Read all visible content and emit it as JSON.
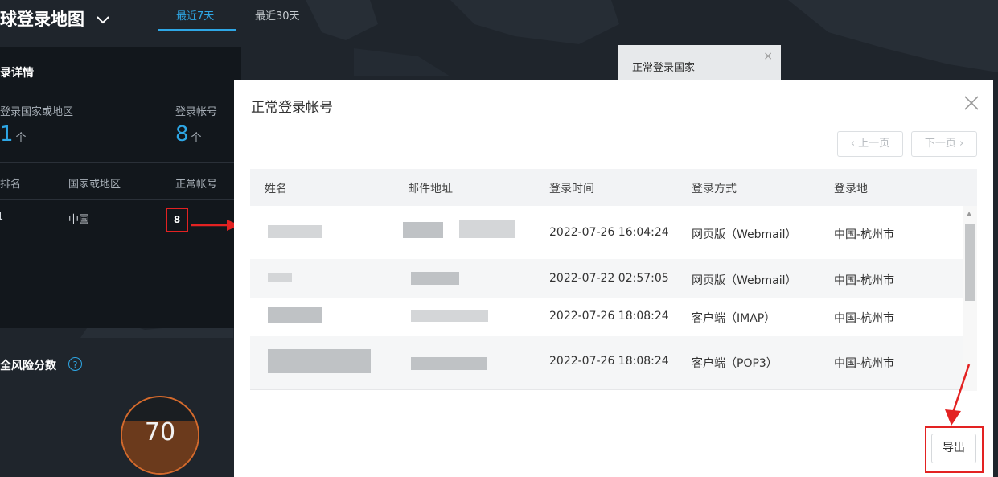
{
  "header": {
    "title": "球登录地图",
    "tabs": [
      {
        "label": "最近7天",
        "active": true
      },
      {
        "label": "最近30天",
        "active": false
      }
    ]
  },
  "details": {
    "title": "录详情",
    "countries_label": "登录国家或地区",
    "countries_value": "1",
    "countries_unit": "个",
    "accounts_label": "登录帐号",
    "accounts_value": "8",
    "accounts_unit": "个",
    "columns": [
      "排名",
      "国家或地区",
      "正常帐号"
    ],
    "rows": [
      {
        "rank": "1",
        "country": "中国",
        "normal": "8"
      }
    ]
  },
  "risk": {
    "title": "全风险分数",
    "help": "?",
    "score": "70"
  },
  "tooltip": {
    "text": "正常登录国家",
    "close": "×"
  },
  "modal": {
    "title": "正常登录帐号",
    "prev_label": "‹ 上一页",
    "next_label": "下一页 ›",
    "columns": [
      "姓名",
      "邮件地址",
      "登录时间",
      "登录方式",
      "登录地"
    ],
    "rows": [
      {
        "time": "2022-07-26 16:04:24",
        "method": "网页版（Webmail）",
        "location": "中国-杭州市"
      },
      {
        "time": "2022-07-22 02:57:05",
        "method": "网页版（Webmail）",
        "location": "中国-杭州市"
      },
      {
        "time": "2022-07-26 18:08:24",
        "method": "客户端（IMAP）",
        "location": "中国-杭州市"
      },
      {
        "time": "2022-07-26 18:08:24",
        "method": "客户端（POP3）",
        "location": "中国-杭州市"
      }
    ],
    "export_label": "导出"
  },
  "colors": {
    "accent": "#2ea7e6",
    "highlight": "#e32222",
    "score_ring": "#d46a2c"
  }
}
